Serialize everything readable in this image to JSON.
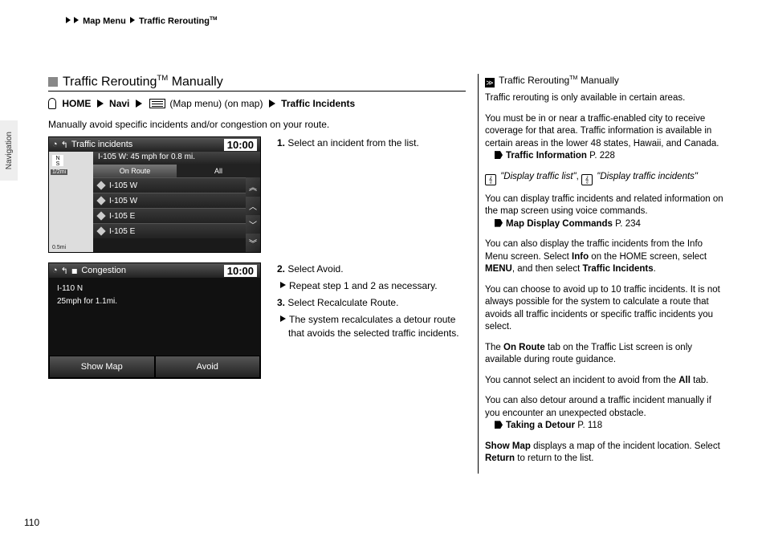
{
  "breadcrumb": {
    "a": "Map Menu",
    "b": "Traffic Rerouting",
    "tm": "TM"
  },
  "sidetab": "Navigation",
  "section": {
    "title_a": "Traffic Rerouting",
    "title_tm": "TM",
    "title_b": " Manually"
  },
  "path": {
    "home": "HOME",
    "navi": "Navi",
    "mapmenu": "(Map menu) (on map)",
    "tail": "Traffic Incidents"
  },
  "intro": "Manually avoid specific incidents and/or congestion on your route.",
  "shot1": {
    "title": "Traffic incidents",
    "clock": "10:00",
    "ns": "N\nS",
    "dist": "1/2mi",
    "scale": "0.5mi",
    "head": "I-105 W: 45 mph for 0.8 mi.",
    "tab_a": "On Route",
    "tab_b": "All",
    "items": [
      "I-105 W",
      "I-105 W",
      "I-105 E",
      "I-105 E"
    ]
  },
  "step1": "Select an incident from the list.",
  "shot2": {
    "title": "Congestion",
    "clock": "10:00",
    "line1": "I-110 N",
    "line2": "25mph for 1.1mi.",
    "btn_a": "Show Map",
    "btn_b": "Avoid"
  },
  "steps2": {
    "a_num": "2.",
    "a_txt": " Select ",
    "a_bold": "Avoid",
    "a_txt2": ".",
    "b": "Repeat step 1 and 2 as necessary.",
    "c_num": "3.",
    "c_txt": " Select ",
    "c_bold": "Recalculate Route",
    "c_txt2": ".",
    "d": "The system recalculates a detour route that avoids the selected traffic incidents."
  },
  "aside": {
    "title_a": "Traffic Rerouting",
    "title_tm": "TM",
    "title_b": " Manually",
    "p1": "Traffic rerouting is only available in certain areas.",
    "p2": "You must be in or near a traffic-enabled city to receive coverage for that area. Traffic information is available in certain areas in the lower 48 states, Hawaii, and Canada.",
    "ref1_a": "Traffic Information",
    "ref1_b": " P. 228",
    "v1": "\"Display traffic list\"",
    "v_sep": ",  ",
    "v2": "\"Display traffic incidents\"",
    "p3": "You can display traffic incidents and related information on the map screen using voice commands.",
    "ref2_a": "Map Display Commands",
    "ref2_b": " P. 234",
    "p4_a": "You can also display the traffic incidents from the Info Menu screen. Select ",
    "p4_b": "Info",
    "p4_c": " on the HOME screen, select ",
    "p4_d": "MENU",
    "p4_e": ", and then select ",
    "p4_f": "Traffic Incidents",
    "p4_g": ".",
    "p5": "You can choose to avoid up to 10 traffic incidents. It is not always possible for the system to calculate a route that avoids all traffic incidents or specific traffic incidents you select.",
    "p6_a": "The ",
    "p6_b": "On Route",
    "p6_c": " tab on the Traffic List screen is only available during route guidance.",
    "p7_a": "You cannot select an incident to avoid from the ",
    "p7_b": "All",
    "p7_c": " tab.",
    "p8": "You can also detour around a traffic incident manually if you encounter an unexpected obstacle.",
    "ref3_a": "Taking a Detour",
    "ref3_b": " P. 118",
    "p9_a": "Show Map",
    "p9_b": " displays a map of the incident location. Select ",
    "p9_c": "Return",
    "p9_d": " to return to the list."
  },
  "pagenum": "110"
}
